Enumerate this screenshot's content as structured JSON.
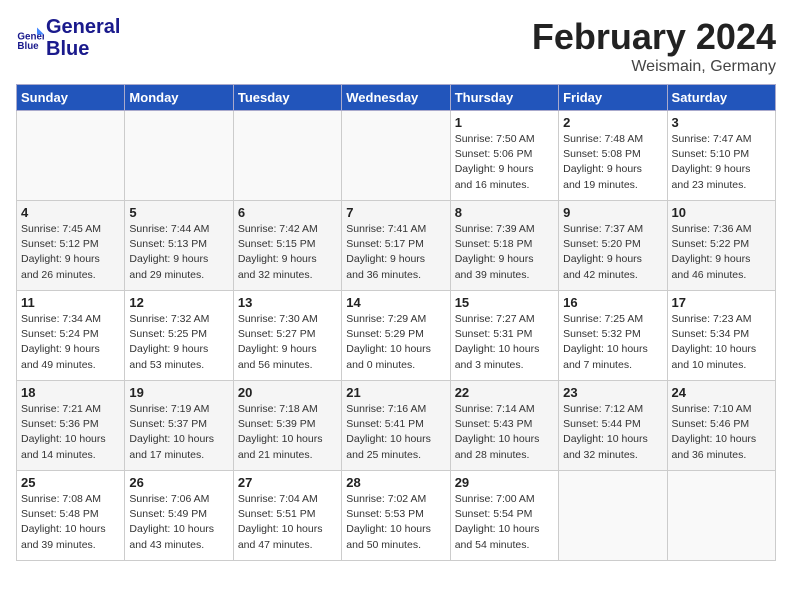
{
  "header": {
    "logo_line1": "General",
    "logo_line2": "Blue",
    "month_year": "February 2024",
    "location": "Weismain, Germany"
  },
  "weekdays": [
    "Sunday",
    "Monday",
    "Tuesday",
    "Wednesday",
    "Thursday",
    "Friday",
    "Saturday"
  ],
  "weeks": [
    [
      {
        "day": "",
        "info": ""
      },
      {
        "day": "",
        "info": ""
      },
      {
        "day": "",
        "info": ""
      },
      {
        "day": "",
        "info": ""
      },
      {
        "day": "1",
        "info": "Sunrise: 7:50 AM\nSunset: 5:06 PM\nDaylight: 9 hours\nand 16 minutes."
      },
      {
        "day": "2",
        "info": "Sunrise: 7:48 AM\nSunset: 5:08 PM\nDaylight: 9 hours\nand 19 minutes."
      },
      {
        "day": "3",
        "info": "Sunrise: 7:47 AM\nSunset: 5:10 PM\nDaylight: 9 hours\nand 23 minutes."
      }
    ],
    [
      {
        "day": "4",
        "info": "Sunrise: 7:45 AM\nSunset: 5:12 PM\nDaylight: 9 hours\nand 26 minutes."
      },
      {
        "day": "5",
        "info": "Sunrise: 7:44 AM\nSunset: 5:13 PM\nDaylight: 9 hours\nand 29 minutes."
      },
      {
        "day": "6",
        "info": "Sunrise: 7:42 AM\nSunset: 5:15 PM\nDaylight: 9 hours\nand 32 minutes."
      },
      {
        "day": "7",
        "info": "Sunrise: 7:41 AM\nSunset: 5:17 PM\nDaylight: 9 hours\nand 36 minutes."
      },
      {
        "day": "8",
        "info": "Sunrise: 7:39 AM\nSunset: 5:18 PM\nDaylight: 9 hours\nand 39 minutes."
      },
      {
        "day": "9",
        "info": "Sunrise: 7:37 AM\nSunset: 5:20 PM\nDaylight: 9 hours\nand 42 minutes."
      },
      {
        "day": "10",
        "info": "Sunrise: 7:36 AM\nSunset: 5:22 PM\nDaylight: 9 hours\nand 46 minutes."
      }
    ],
    [
      {
        "day": "11",
        "info": "Sunrise: 7:34 AM\nSunset: 5:24 PM\nDaylight: 9 hours\nand 49 minutes."
      },
      {
        "day": "12",
        "info": "Sunrise: 7:32 AM\nSunset: 5:25 PM\nDaylight: 9 hours\nand 53 minutes."
      },
      {
        "day": "13",
        "info": "Sunrise: 7:30 AM\nSunset: 5:27 PM\nDaylight: 9 hours\nand 56 minutes."
      },
      {
        "day": "14",
        "info": "Sunrise: 7:29 AM\nSunset: 5:29 PM\nDaylight: 10 hours\nand 0 minutes."
      },
      {
        "day": "15",
        "info": "Sunrise: 7:27 AM\nSunset: 5:31 PM\nDaylight: 10 hours\nand 3 minutes."
      },
      {
        "day": "16",
        "info": "Sunrise: 7:25 AM\nSunset: 5:32 PM\nDaylight: 10 hours\nand 7 minutes."
      },
      {
        "day": "17",
        "info": "Sunrise: 7:23 AM\nSunset: 5:34 PM\nDaylight: 10 hours\nand 10 minutes."
      }
    ],
    [
      {
        "day": "18",
        "info": "Sunrise: 7:21 AM\nSunset: 5:36 PM\nDaylight: 10 hours\nand 14 minutes."
      },
      {
        "day": "19",
        "info": "Sunrise: 7:19 AM\nSunset: 5:37 PM\nDaylight: 10 hours\nand 17 minutes."
      },
      {
        "day": "20",
        "info": "Sunrise: 7:18 AM\nSunset: 5:39 PM\nDaylight: 10 hours\nand 21 minutes."
      },
      {
        "day": "21",
        "info": "Sunrise: 7:16 AM\nSunset: 5:41 PM\nDaylight: 10 hours\nand 25 minutes."
      },
      {
        "day": "22",
        "info": "Sunrise: 7:14 AM\nSunset: 5:43 PM\nDaylight: 10 hours\nand 28 minutes."
      },
      {
        "day": "23",
        "info": "Sunrise: 7:12 AM\nSunset: 5:44 PM\nDaylight: 10 hours\nand 32 minutes."
      },
      {
        "day": "24",
        "info": "Sunrise: 7:10 AM\nSunset: 5:46 PM\nDaylight: 10 hours\nand 36 minutes."
      }
    ],
    [
      {
        "day": "25",
        "info": "Sunrise: 7:08 AM\nSunset: 5:48 PM\nDaylight: 10 hours\nand 39 minutes."
      },
      {
        "day": "26",
        "info": "Sunrise: 7:06 AM\nSunset: 5:49 PM\nDaylight: 10 hours\nand 43 minutes."
      },
      {
        "day": "27",
        "info": "Sunrise: 7:04 AM\nSunset: 5:51 PM\nDaylight: 10 hours\nand 47 minutes."
      },
      {
        "day": "28",
        "info": "Sunrise: 7:02 AM\nSunset: 5:53 PM\nDaylight: 10 hours\nand 50 minutes."
      },
      {
        "day": "29",
        "info": "Sunrise: 7:00 AM\nSunset: 5:54 PM\nDaylight: 10 hours\nand 54 minutes."
      },
      {
        "day": "",
        "info": ""
      },
      {
        "day": "",
        "info": ""
      }
    ]
  ]
}
